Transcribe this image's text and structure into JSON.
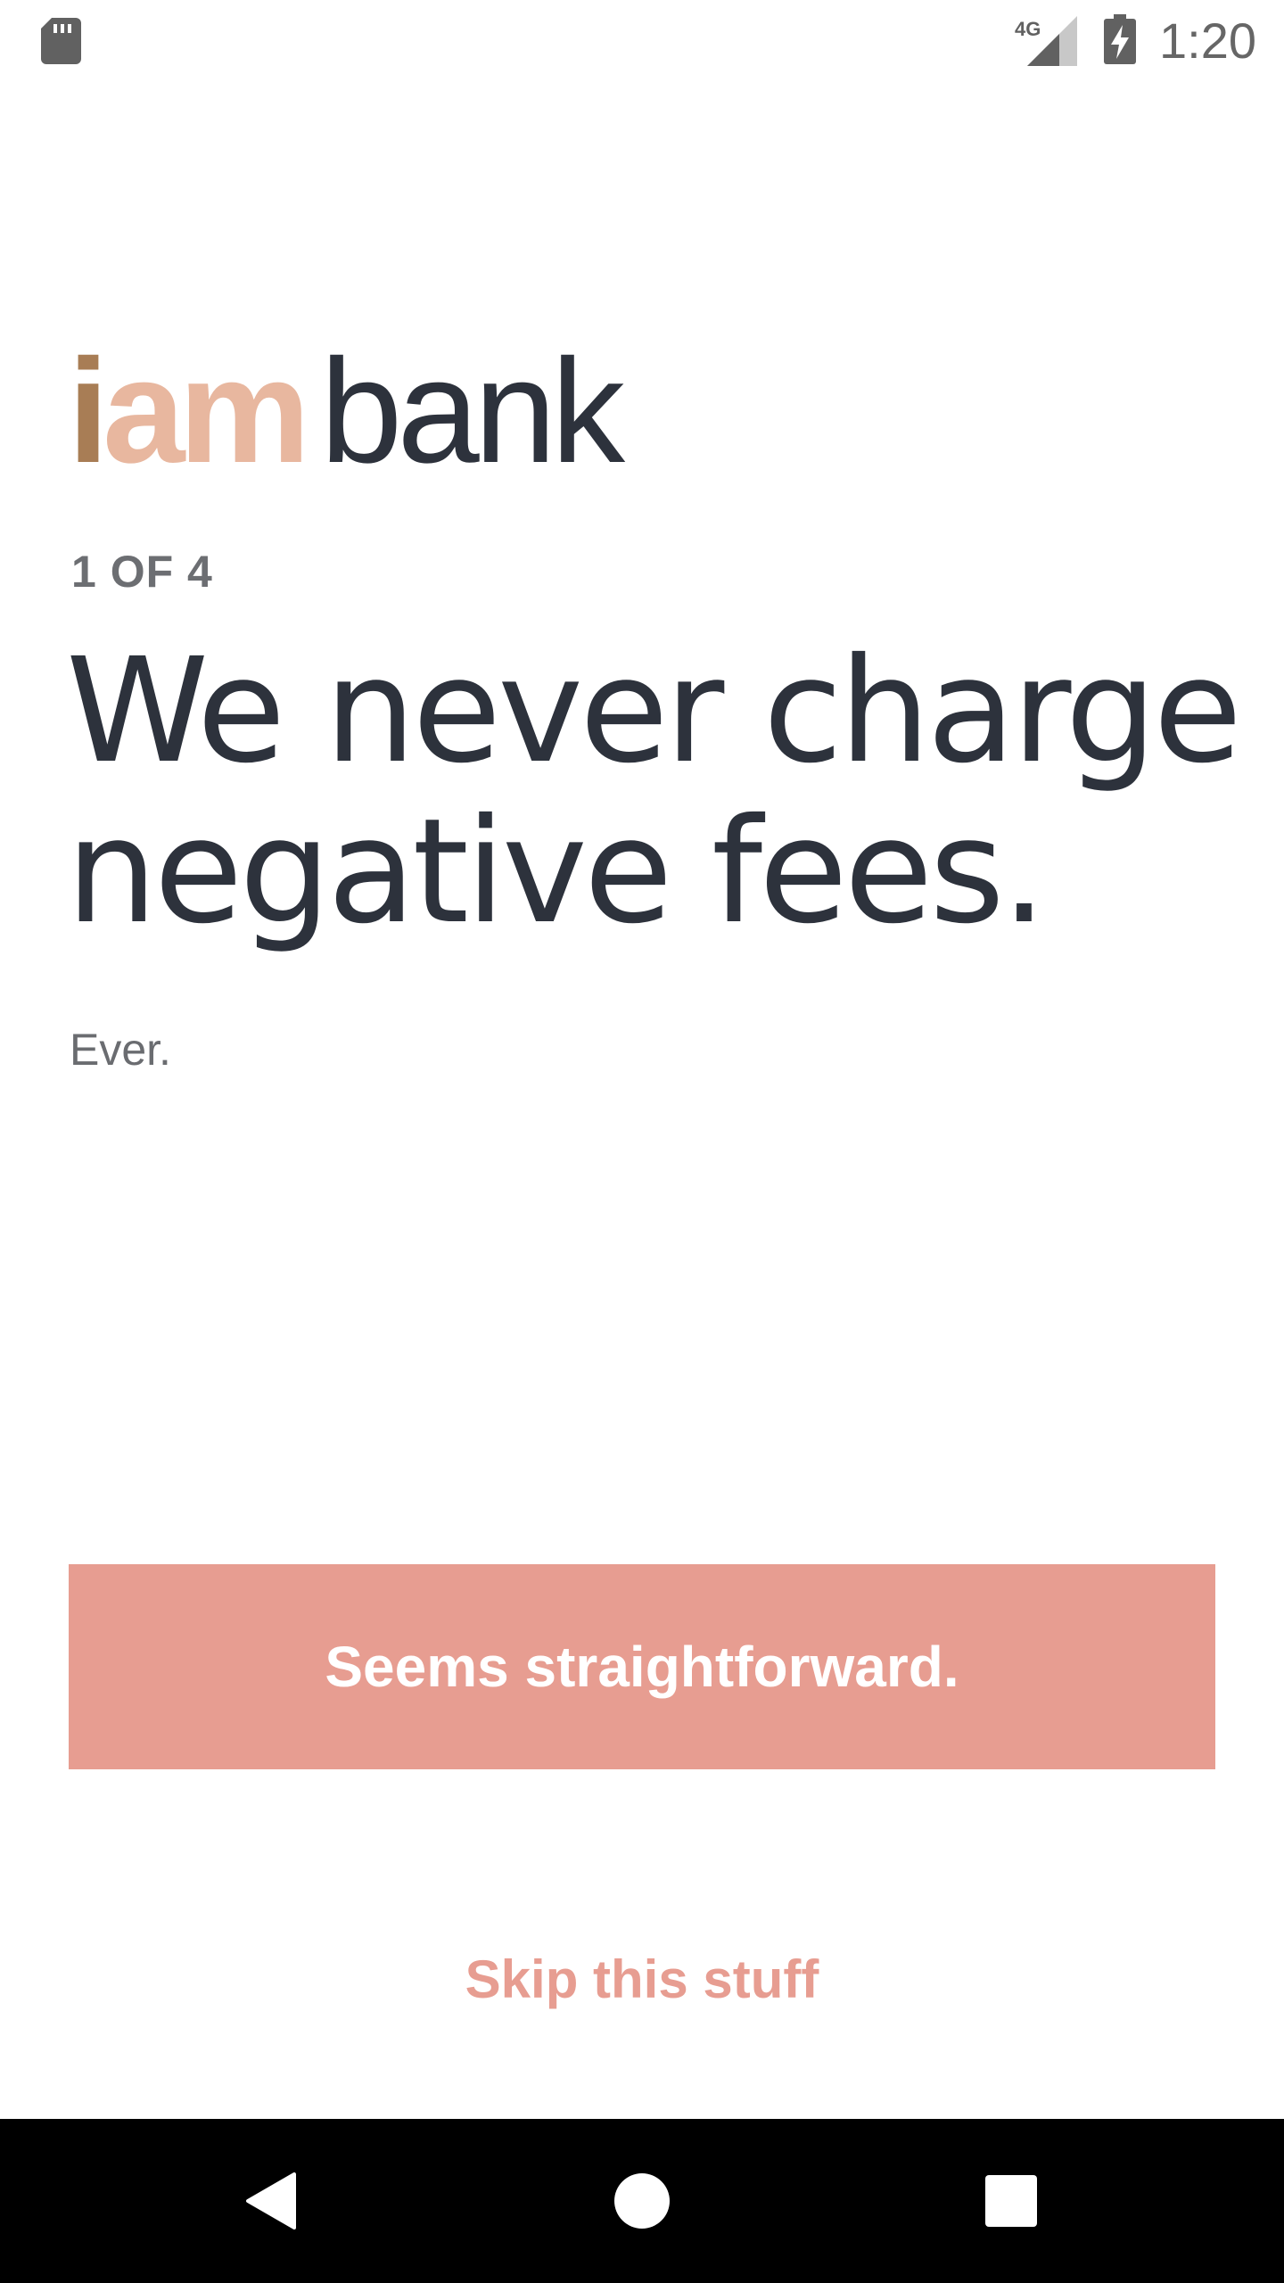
{
  "status_bar": {
    "time": "1:20",
    "network_label": "4G",
    "icons": [
      "sd-card-icon",
      "cellular-signal-icon",
      "battery-charging-icon"
    ]
  },
  "logo": {
    "part_i": "i",
    "part_am": "am",
    "part_bank": "bank",
    "colors": {
      "i": "#a87d55",
      "am": "#e8b79f",
      "bank": "#2d323c"
    }
  },
  "onboarding": {
    "step_counter": "1 OF 4",
    "headline_line1": "We never charge",
    "headline_line2": "negative fees.",
    "subtext": "Ever.",
    "primary_button_label": "Seems straightforward.",
    "skip_label": "Skip this stuff"
  },
  "theme": {
    "accent": "#e79d91",
    "text_dark": "#2d323c",
    "text_muted": "#6a6c70"
  },
  "navigation_bar": {
    "buttons": [
      "back-icon",
      "home-icon",
      "recents-icon"
    ]
  }
}
